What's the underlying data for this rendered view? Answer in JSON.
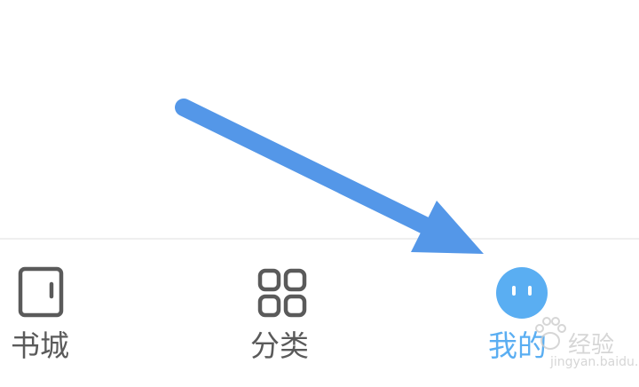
{
  "tabbar": {
    "tabs": [
      {
        "id": "bookstore",
        "label": "书城",
        "icon": "book-icon",
        "active": false
      },
      {
        "id": "category",
        "label": "分类",
        "icon": "grid-icon",
        "active": false
      },
      {
        "id": "mine",
        "label": "我的",
        "icon": "face-icon",
        "active": true
      }
    ]
  },
  "colors": {
    "accent": "#5aaef2",
    "inactive": "#5a5a5a",
    "arrow": "#5497e8",
    "divider": "#efefef"
  },
  "watermark": {
    "text": "经验",
    "url": "jingyan.baidu.com"
  }
}
